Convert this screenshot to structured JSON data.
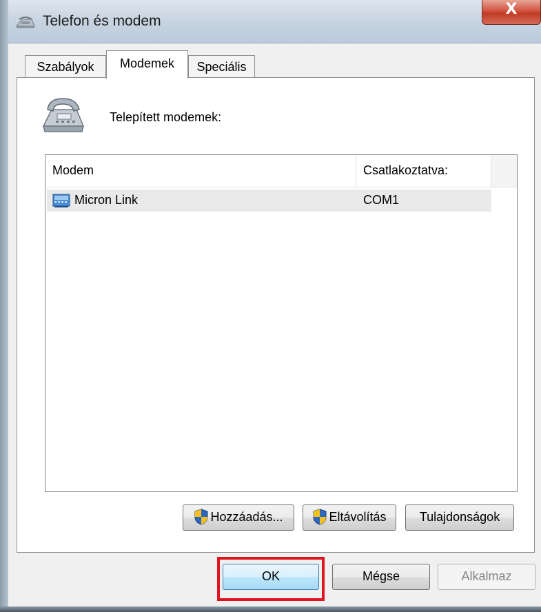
{
  "window": {
    "title": "Telefon és modem",
    "close_glyph": "X",
    "title_icon": "phone-modem-icon"
  },
  "tabs": [
    {
      "label": "Szabályok",
      "selected": false
    },
    {
      "label": "Modemek",
      "selected": true
    },
    {
      "label": "Speciális",
      "selected": false
    }
  ],
  "modems_panel": {
    "icon": "telephone-icon",
    "installed_label": "Telepített modemek:",
    "list": {
      "columns": [
        "Modem",
        "Csatlakoztatva:"
      ],
      "rows": [
        {
          "name": "Micron Link",
          "port": "COM1",
          "icon": "modem-device-icon"
        }
      ]
    },
    "buttons": {
      "add": "Hozzáadás...",
      "remove": "Eltávolítás",
      "properties": "Tulajdonságok"
    }
  },
  "dialog_buttons": {
    "ok": "OK",
    "cancel": "Mégse",
    "apply": "Alkalmaz"
  },
  "colors": {
    "highlight": "#e0141e",
    "close_button": "#c03b26",
    "selected_row": "#e9e9e9"
  }
}
